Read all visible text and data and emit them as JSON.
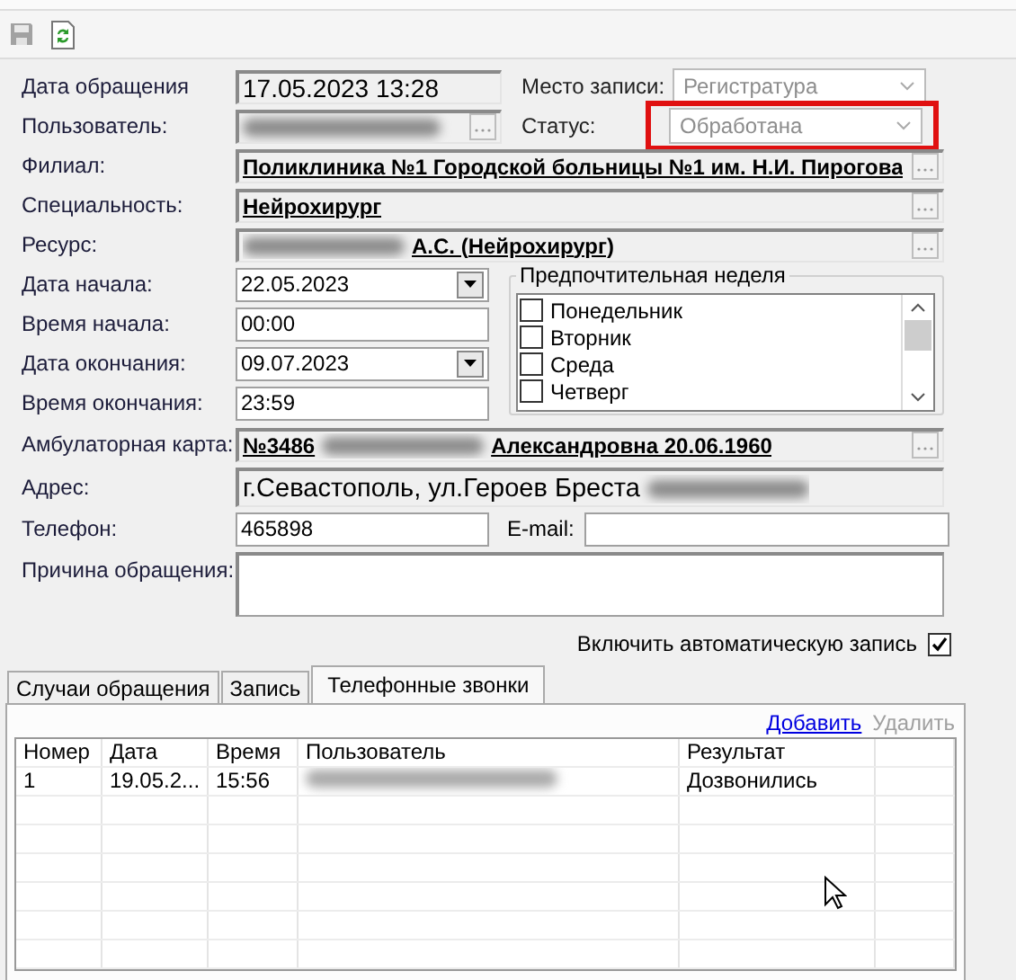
{
  "toolbar": [
    {
      "kind": "save",
      "disabled": true
    },
    {
      "kind": "refresh",
      "disabled": false
    }
  ],
  "header": {
    "date_label": "Дата обращения",
    "date_value": "17.05.2023 13:28",
    "place_label": "Место записи:",
    "place_value": "Регистратура",
    "user_label": "Пользователь:",
    "user_redacted": true,
    "status_label": "Статус:",
    "status_value": "Обработана",
    "status_highlighted": true
  },
  "lookups": [
    {
      "label": "Филиал:",
      "segments": [
        {
          "kind": "text",
          "text": "Поликлиника №1 Городской больницы №1 им. Н.И. Пирогова"
        }
      ]
    },
    {
      "label": "Специальность:",
      "segments": [
        {
          "kind": "text",
          "text": "Нейрохирург"
        }
      ]
    },
    {
      "label": "Ресурс:",
      "segments": [
        {
          "kind": "redacted"
        },
        {
          "kind": "text",
          "text": "А.С. (Нейрохирург)"
        }
      ]
    }
  ],
  "schedule": [
    {
      "label": "Дата начала:",
      "value": "22.05.2023",
      "kind": "date"
    },
    {
      "label": "Время начала:",
      "value": "00:00",
      "kind": "text"
    },
    {
      "label": "Дата окончания:",
      "value": "09.07.2023",
      "kind": "date"
    },
    {
      "label": "Время окончания:",
      "value": "23:59",
      "kind": "text"
    }
  ],
  "week": {
    "title": "Предпочтительная неделя",
    "days": [
      {
        "label": "Понедельник",
        "checked": false
      },
      {
        "label": "Вторник",
        "checked": false
      },
      {
        "label": "Среда",
        "checked": false
      },
      {
        "label": "Четверг",
        "checked": false
      }
    ]
  },
  "card": {
    "label": "Амбулаторная карта:",
    "segments": [
      {
        "kind": "text",
        "text": "№3486"
      },
      {
        "kind": "redacted"
      },
      {
        "kind": "text",
        "text": "Александровна 20.06.1960"
      }
    ]
  },
  "address": {
    "label": "Адрес:",
    "segments": [
      {
        "kind": "text",
        "text": "г.Севастополь, ул.Героев Бреста"
      },
      {
        "kind": "redacted"
      }
    ]
  },
  "phone": {
    "label": "Телефон:",
    "value": "465898"
  },
  "email": {
    "label": "E-mail:"
  },
  "reason": {
    "label": "Причина обращения:"
  },
  "auto_record": {
    "label": "Включить автоматическую запись",
    "checked": true
  },
  "tabs": [
    {
      "label": "Случаи обращения",
      "selected": false
    },
    {
      "label": "Запись",
      "selected": false
    },
    {
      "label": "Телефонные звонки",
      "selected": true
    }
  ],
  "actions": [
    {
      "label": "Добавить",
      "disabled": false
    },
    {
      "label": "Удалить",
      "disabled": true
    }
  ],
  "table": {
    "columns": [
      "Номер",
      "Дата",
      "Время",
      "Пользователь",
      "Результат"
    ],
    "rows": [
      {
        "number": "1",
        "date": "19.05.2...",
        "time": "15:56",
        "user_redacted": true,
        "result": "Дозвонились"
      }
    ]
  }
}
